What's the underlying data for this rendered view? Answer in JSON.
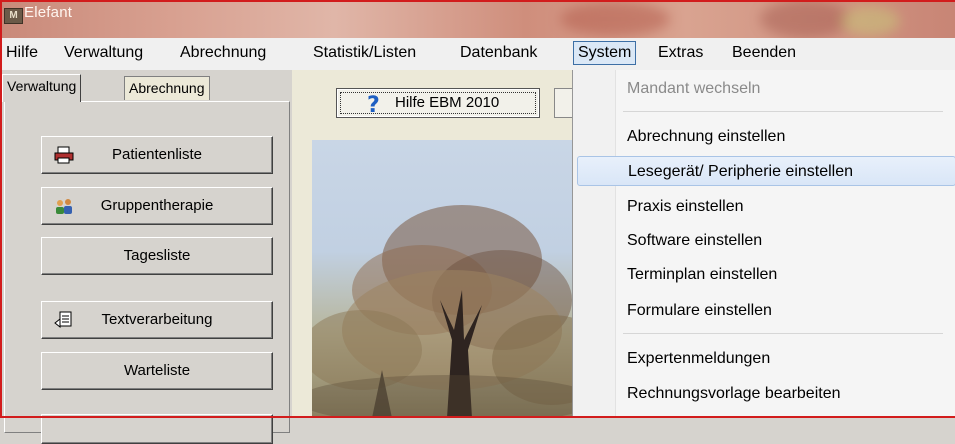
{
  "window": {
    "title": "Elefant",
    "icon_text": "M"
  },
  "menubar": {
    "items": [
      {
        "label": "Hilfe"
      },
      {
        "label": "Verwaltung"
      },
      {
        "label": "Abrechnung"
      },
      {
        "label": "Statistik/Listen"
      },
      {
        "label": "Datenbank"
      },
      {
        "label": "System"
      },
      {
        "label": "Extras"
      },
      {
        "label": "Beenden"
      }
    ],
    "active": "System"
  },
  "left_panel": {
    "tabs": [
      {
        "label": "Verwaltung"
      },
      {
        "label": "Abrechnung"
      }
    ],
    "buttons": [
      {
        "label": "Patientenliste",
        "icon": "printer-icon"
      },
      {
        "label": "Gruppentherapie",
        "icon": "group-icon"
      },
      {
        "label": "Tagesliste",
        "icon": ""
      },
      {
        "label": "Textverarbeitung",
        "icon": "document-icon"
      },
      {
        "label": "Warteliste",
        "icon": ""
      }
    ]
  },
  "center": {
    "help_button": {
      "label": "Hilfe EBM 2010",
      "icon": "question-mark-icon"
    }
  },
  "system_menu": {
    "items": [
      {
        "label": "Mandant wechseln",
        "state": "disabled"
      },
      {
        "label": "Abrechnung einstellen",
        "state": "normal"
      },
      {
        "label": "Lesegerät/ Peripherie einstellen",
        "state": "hover"
      },
      {
        "label": "Praxis einstellen",
        "state": "normal"
      },
      {
        "label": "Software einstellen",
        "state": "normal"
      },
      {
        "label": "Terminplan einstellen",
        "state": "normal"
      },
      {
        "label": "Formulare einstellen",
        "state": "normal"
      },
      {
        "label": "Expertenmeldungen",
        "state": "normal"
      },
      {
        "label": "Rechnungsvorlage bearbeiten",
        "state": "normal"
      }
    ]
  },
  "colors": {
    "frame": "#d21c1c",
    "menu_active_border": "#3d6fa5",
    "help_icon": "#1e5fc2"
  }
}
